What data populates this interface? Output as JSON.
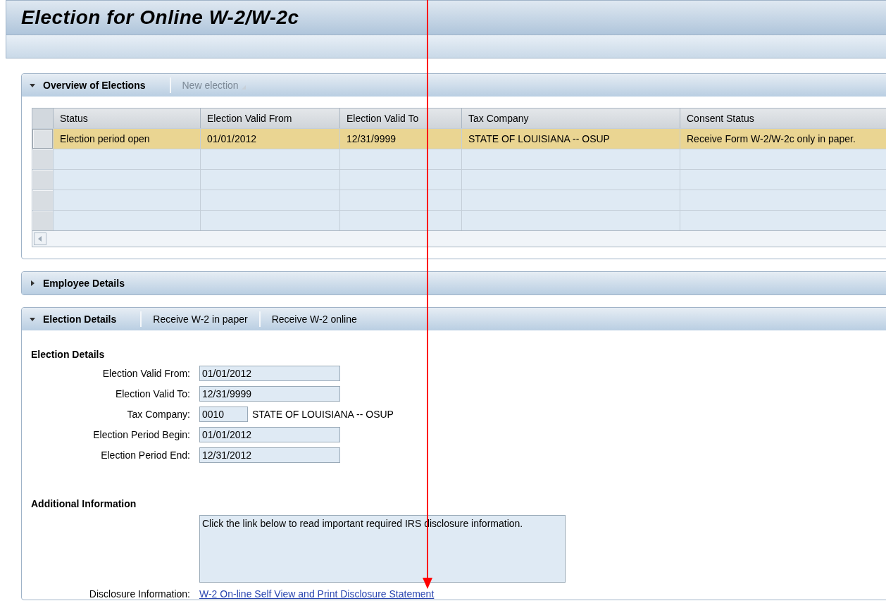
{
  "window": {
    "title": "Election for Online W-2/W-2c"
  },
  "panels": [
    {
      "kind": "table",
      "title": "Overview of Elections",
      "expanded": true,
      "toolbar": [
        {
          "label": "New election",
          "disabled": true,
          "menu": true
        }
      ],
      "table": {
        "columns": [
          "Status",
          "Election Valid From",
          "Election Valid To",
          "Tax Company",
          "Consent Status"
        ],
        "rows": [
          {
            "selected": true,
            "cells": [
              "Election period open",
              "01/01/2012",
              "12/31/9999",
              "STATE OF LOUISIANA -- OSUP",
              "Receive Form W-2/W-2c only in paper."
            ]
          }
        ]
      }
    },
    {
      "title": "Employee Details",
      "expanded": false
    },
    {
      "kind": "form",
      "title": "Election Details",
      "expanded": true,
      "toolbar": [
        {
          "label": "Receive W-2 in paper",
          "disabled": false,
          "menu": false
        },
        {
          "label": "Receive W-2 online",
          "disabled": false,
          "menu": false
        }
      ],
      "sections": [
        {
          "heading": "Election Details",
          "fields": [
            {
              "label": "Election Valid From:",
              "value": "01/01/2012"
            },
            {
              "label": "Election Valid To:",
              "value": "12/31/9999"
            },
            {
              "label": "Tax Company:",
              "value": "0010",
              "description": "STATE OF LOUISIANA -- OSUP"
            },
            {
              "label": "Election Period Begin:",
              "value": "01/01/2012"
            },
            {
              "label": "Election Period End:",
              "value": "12/31/2012"
            }
          ]
        },
        {
          "heading": "Additional Information",
          "note": "Click the link below to read important required IRS disclosure information.",
          "link_label": "Disclosure Information:",
          "link": "W-2 On-line Self View and Print Disclosure Statement"
        }
      ]
    }
  ],
  "annotation": {
    "kind": "arrow"
  }
}
